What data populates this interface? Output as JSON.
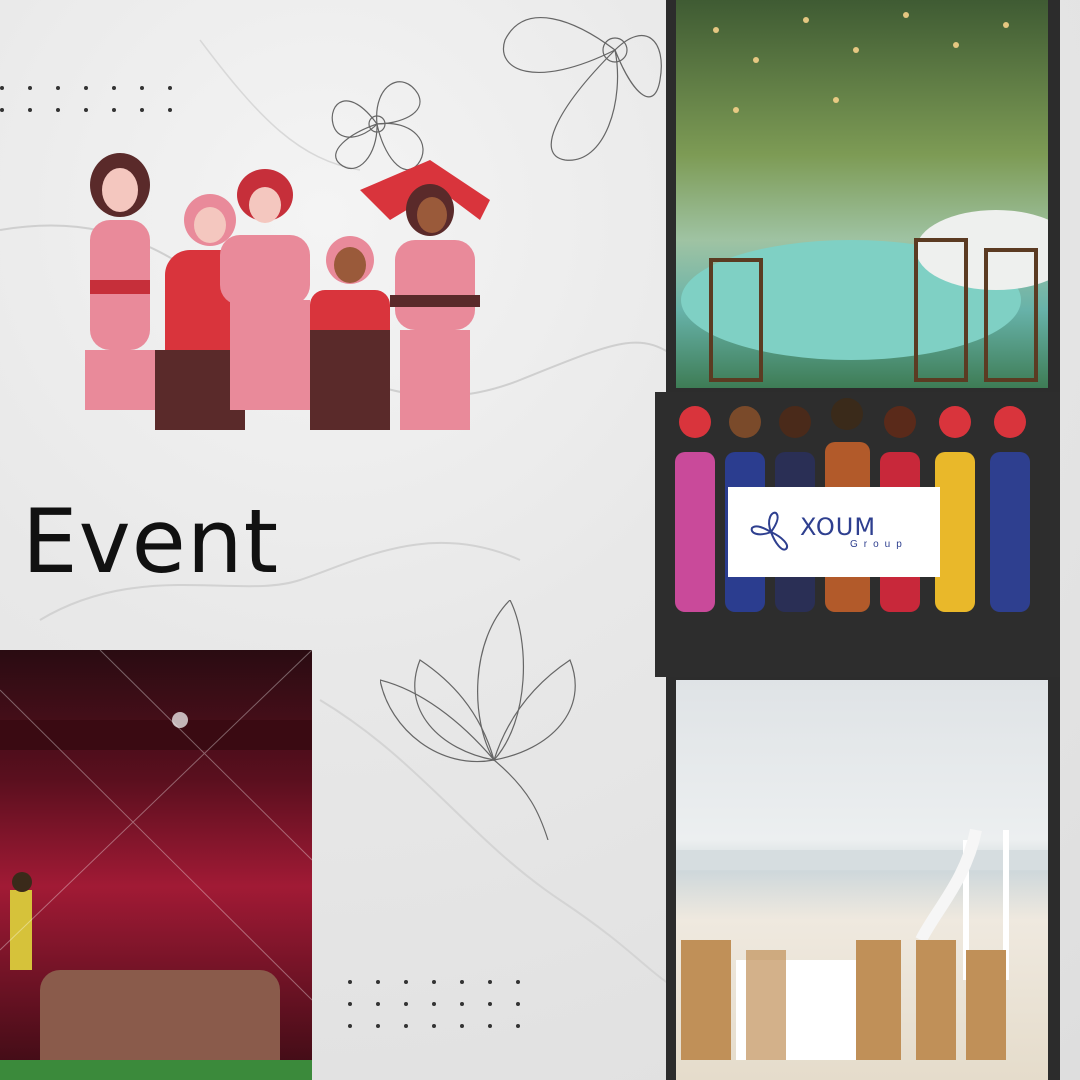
{
  "heading": "Event",
  "logo": {
    "name": "XOUM",
    "sub": "Group",
    "color": "#2e3f8f"
  },
  "images": {
    "women_group": "illustration of five women in pink and red outfits",
    "garden": "outdoor wedding dinner tables under string lights",
    "fashion": "fashion illustration lineup of models",
    "beach": "beach wedding ceremony setup with bamboo chairs",
    "stage": "theater stage with red curtains and performer"
  },
  "colors": {
    "text": "#111111",
    "dark_strip": "#2c2c2c",
    "pink": "#e98a9a",
    "red": "#d9343c"
  }
}
